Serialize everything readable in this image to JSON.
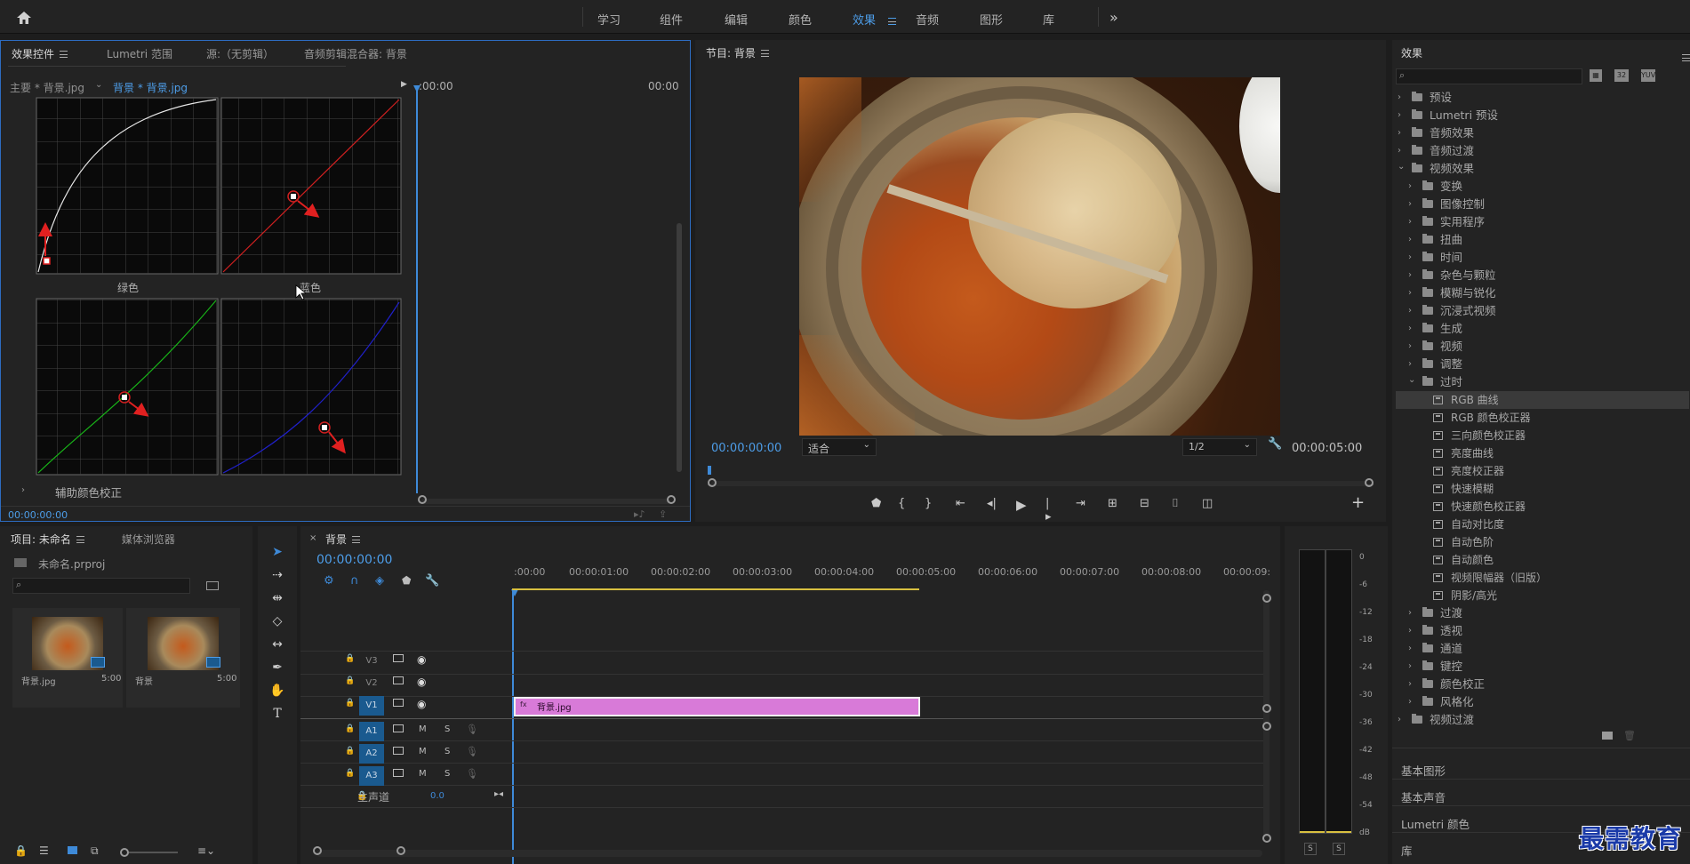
{
  "workspace": {
    "home_icon": "home-icon",
    "tabs": [
      "学习",
      "组件",
      "编辑",
      "颜色",
      "效果",
      "音频",
      "图形",
      "库"
    ],
    "active_tab": "效果",
    "more_icon": "chevron-double-right-icon"
  },
  "effect_controls": {
    "tabs": [
      "效果控件",
      "Lumetri 范围",
      "源:（无剪辑）",
      "音频剪辑混合器: 背景"
    ],
    "clip_master": "主要 * 背景.jpg",
    "clip_selected": "背景 * 背景.jpg",
    "time_start": ":00:00",
    "time_end": "00:00",
    "curve_labels": [
      "绿色",
      "蓝色"
    ],
    "secondary_section": "辅助颜色校正",
    "timecode": "00:00:00:00",
    "curve_colors": {
      "master": "#e8e8e8",
      "red": "#d02020",
      "green": "#18b418",
      "blue": "#2020c8"
    }
  },
  "program": {
    "title": "节目: 背景",
    "timecode": "00:00:00:00",
    "fit": "适合",
    "resolution": "1/2",
    "duration": "00:00:05:00"
  },
  "effects_panel": {
    "title": "效果",
    "search_placeholder": "",
    "items": [
      {
        "label": "预设",
        "level": 0,
        "open": false,
        "type": "folder"
      },
      {
        "label": "Lumetri 预设",
        "level": 0,
        "open": false,
        "type": "folder"
      },
      {
        "label": "音频效果",
        "level": 0,
        "open": false,
        "type": "folder"
      },
      {
        "label": "音频过渡",
        "level": 0,
        "open": false,
        "type": "folder"
      },
      {
        "label": "视频效果",
        "level": 0,
        "open": true,
        "type": "folder"
      },
      {
        "label": "变换",
        "level": 1,
        "open": false,
        "type": "folder"
      },
      {
        "label": "图像控制",
        "level": 1,
        "open": false,
        "type": "folder"
      },
      {
        "label": "实用程序",
        "level": 1,
        "open": false,
        "type": "folder"
      },
      {
        "label": "扭曲",
        "level": 1,
        "open": false,
        "type": "folder"
      },
      {
        "label": "时间",
        "level": 1,
        "open": false,
        "type": "folder"
      },
      {
        "label": "杂色与颗粒",
        "level": 1,
        "open": false,
        "type": "folder"
      },
      {
        "label": "模糊与锐化",
        "level": 1,
        "open": false,
        "type": "folder"
      },
      {
        "label": "沉浸式视频",
        "level": 1,
        "open": false,
        "type": "folder"
      },
      {
        "label": "生成",
        "level": 1,
        "open": false,
        "type": "folder"
      },
      {
        "label": "视频",
        "level": 1,
        "open": false,
        "type": "folder"
      },
      {
        "label": "调整",
        "level": 1,
        "open": false,
        "type": "folder"
      },
      {
        "label": "过时",
        "level": 1,
        "open": true,
        "type": "folder"
      },
      {
        "label": "RGB 曲线",
        "level": 2,
        "type": "effect",
        "selected": true
      },
      {
        "label": "RGB 颜色校正器",
        "level": 2,
        "type": "effect"
      },
      {
        "label": "三向颜色校正器",
        "level": 2,
        "type": "effect"
      },
      {
        "label": "亮度曲线",
        "level": 2,
        "type": "effect"
      },
      {
        "label": "亮度校正器",
        "level": 2,
        "type": "effect"
      },
      {
        "label": "快速模糊",
        "level": 2,
        "type": "effect"
      },
      {
        "label": "快速颜色校正器",
        "level": 2,
        "type": "effect"
      },
      {
        "label": "自动对比度",
        "level": 2,
        "type": "effect"
      },
      {
        "label": "自动色阶",
        "level": 2,
        "type": "effect"
      },
      {
        "label": "自动颜色",
        "level": 2,
        "type": "effect"
      },
      {
        "label": "视频限幅器（旧版）",
        "level": 2,
        "type": "effect"
      },
      {
        "label": "阴影/高光",
        "level": 2,
        "type": "effect"
      },
      {
        "label": "过渡",
        "level": 1,
        "open": false,
        "type": "folder"
      },
      {
        "label": "透视",
        "level": 1,
        "open": false,
        "type": "folder"
      },
      {
        "label": "通道",
        "level": 1,
        "open": false,
        "type": "folder"
      },
      {
        "label": "键控",
        "level": 1,
        "open": false,
        "type": "folder"
      },
      {
        "label": "颜色校正",
        "level": 1,
        "open": false,
        "type": "folder"
      },
      {
        "label": "风格化",
        "level": 1,
        "open": false,
        "type": "folder"
      },
      {
        "label": "视频过渡",
        "level": 0,
        "open": false,
        "type": "folder"
      }
    ],
    "bottom_panels": [
      "基本图形",
      "基本声音",
      "Lumetri 颜色",
      "库"
    ]
  },
  "project": {
    "tabs": [
      "项目: 未命名",
      "媒体浏览器"
    ],
    "file": "未命名.prproj",
    "items": [
      {
        "name": "背景.jpg",
        "duration": "5:00"
      },
      {
        "name": "背景",
        "duration": "5:00"
      }
    ]
  },
  "timeline": {
    "title": "背景",
    "timecode": "00:00:00:00",
    "ruler": [
      ":00:00",
      "00:00:01:00",
      "00:00:02:00",
      "00:00:03:00",
      "00:00:04:00",
      "00:00:05:00",
      "00:00:06:00",
      "00:00:07:00",
      "00:00:08:00",
      "00:00:09:"
    ],
    "video_tracks": [
      "V3",
      "V2",
      "V1"
    ],
    "audio_tracks": [
      "A1",
      "A2",
      "A3"
    ],
    "master_label": "主声道",
    "master_value": "0.0",
    "clip_label": "背景.jpg",
    "clip_color": "#d87ad8"
  },
  "meters": {
    "ticks": [
      "0",
      "-6",
      "-12",
      "-18",
      "-24",
      "-30",
      "-36",
      "-42",
      "-48",
      "-54",
      "dB"
    ],
    "solo": [
      "S",
      "S"
    ]
  },
  "watermark": "最需教育"
}
